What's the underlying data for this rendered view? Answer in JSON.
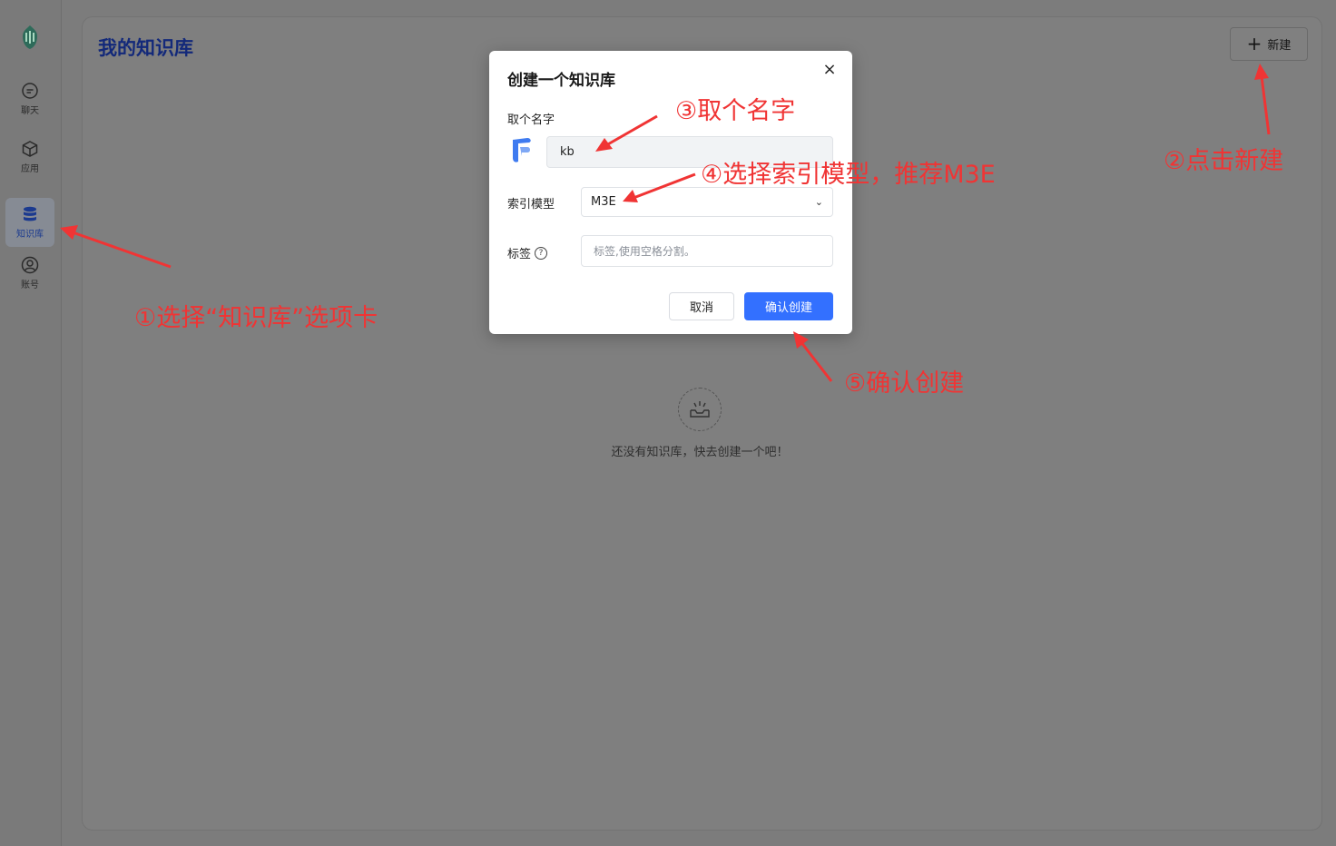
{
  "sidebar": {
    "items": [
      {
        "label": "聊天",
        "icon": "chat-icon"
      },
      {
        "label": "应用",
        "icon": "cube-icon"
      },
      {
        "label": "知识库",
        "icon": "database-icon",
        "active": true
      },
      {
        "label": "账号",
        "icon": "user-icon"
      }
    ]
  },
  "header": {
    "title": "我的知识库",
    "new_button": "新建"
  },
  "empty_state": {
    "text": "还没有知识库，快去创建一个吧！"
  },
  "modal": {
    "title": "创建一个知识库",
    "close": "×",
    "name_label": "取个名字",
    "name_value": "kb",
    "model_label": "索引模型",
    "model_value": "M3E",
    "tags_label": "标签",
    "tags_placeholder": "标签,使用空格分割。",
    "cancel": "取消",
    "confirm": "确认创建"
  },
  "annotations": {
    "step1": "①选择“知识库”选项卡",
    "step2": "②点击新建",
    "step3": "③取个名字",
    "step4": "④选择索引模型，推荐M3E",
    "step5": "⑤确认创建"
  },
  "colors": {
    "accent": "#3370ff",
    "annotation": "#f03434",
    "title": "#13297a"
  }
}
